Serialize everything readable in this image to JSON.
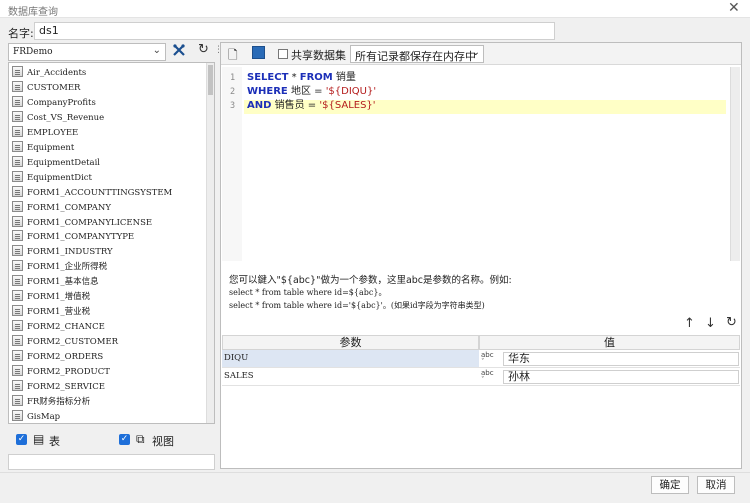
{
  "window": {
    "title": "数据库查询",
    "close_icon": "close-icon"
  },
  "name_row": {
    "label": "名字:",
    "value": "ds1"
  },
  "left_panel": {
    "database": "FRDemo",
    "tables": [
      "Air_Accidents",
      "CUSTOMER",
      "CompanyProfits",
      "Cost_VS_Revenue",
      "EMPLOYEE",
      "Equipment",
      "EquipmentDetail",
      "EquipmentDict",
      "FORM1_ACCOUNTTINGSYSTEM",
      "FORM1_COMPANY",
      "FORM1_COMPANYLICENSE",
      "FORM1_COMPANYTYPE",
      "FORM1_INDUSTRY",
      "FORM1_企业所得税",
      "FORM1_基本信息",
      "FORM1_增值税",
      "FORM1_营业税",
      "FORM2_CHANCE",
      "FORM2_CUSTOMER",
      "FORM2_ORDERS",
      "FORM2_PRODUCT",
      "FORM2_SERVICE",
      "FR财务指标分析",
      "GisMap"
    ],
    "filter_table_label": "表",
    "filter_view_label": "视图"
  },
  "toolbar": {
    "share_label": "共享数据集",
    "cache_mode": "所有记录都保存在内存中"
  },
  "editor": {
    "line_numbers": [
      "1",
      "2",
      "3"
    ],
    "line1": {
      "kw1": "SELECT",
      "mid": " * ",
      "kw2": "FROM",
      "rest": " 销量"
    },
    "line2": {
      "kw": "WHERE",
      "mid": " 地区 = ",
      "str": "'${DIQU}'"
    },
    "line3": {
      "kw": "AND",
      "mid": " 销售员 = ",
      "str": "'${SALES}'"
    }
  },
  "hint": {
    "line1": "您可以鍵入\"${abc}\"做为一个参数，这里abc是参数的名称。例如:",
    "line2": "select * from table where id=${abc}。",
    "line3": "select * from table where id='${abc}'。(如果id字段为字符串类型)"
  },
  "params": {
    "header_name": "参数",
    "header_value": "值",
    "type_label": "abc",
    "rows": [
      {
        "name": "DIQU",
        "value": "华东"
      },
      {
        "name": "SALES",
        "value": "孙林"
      }
    ]
  },
  "buttons": {
    "ok": "确定",
    "cancel": "取消"
  }
}
